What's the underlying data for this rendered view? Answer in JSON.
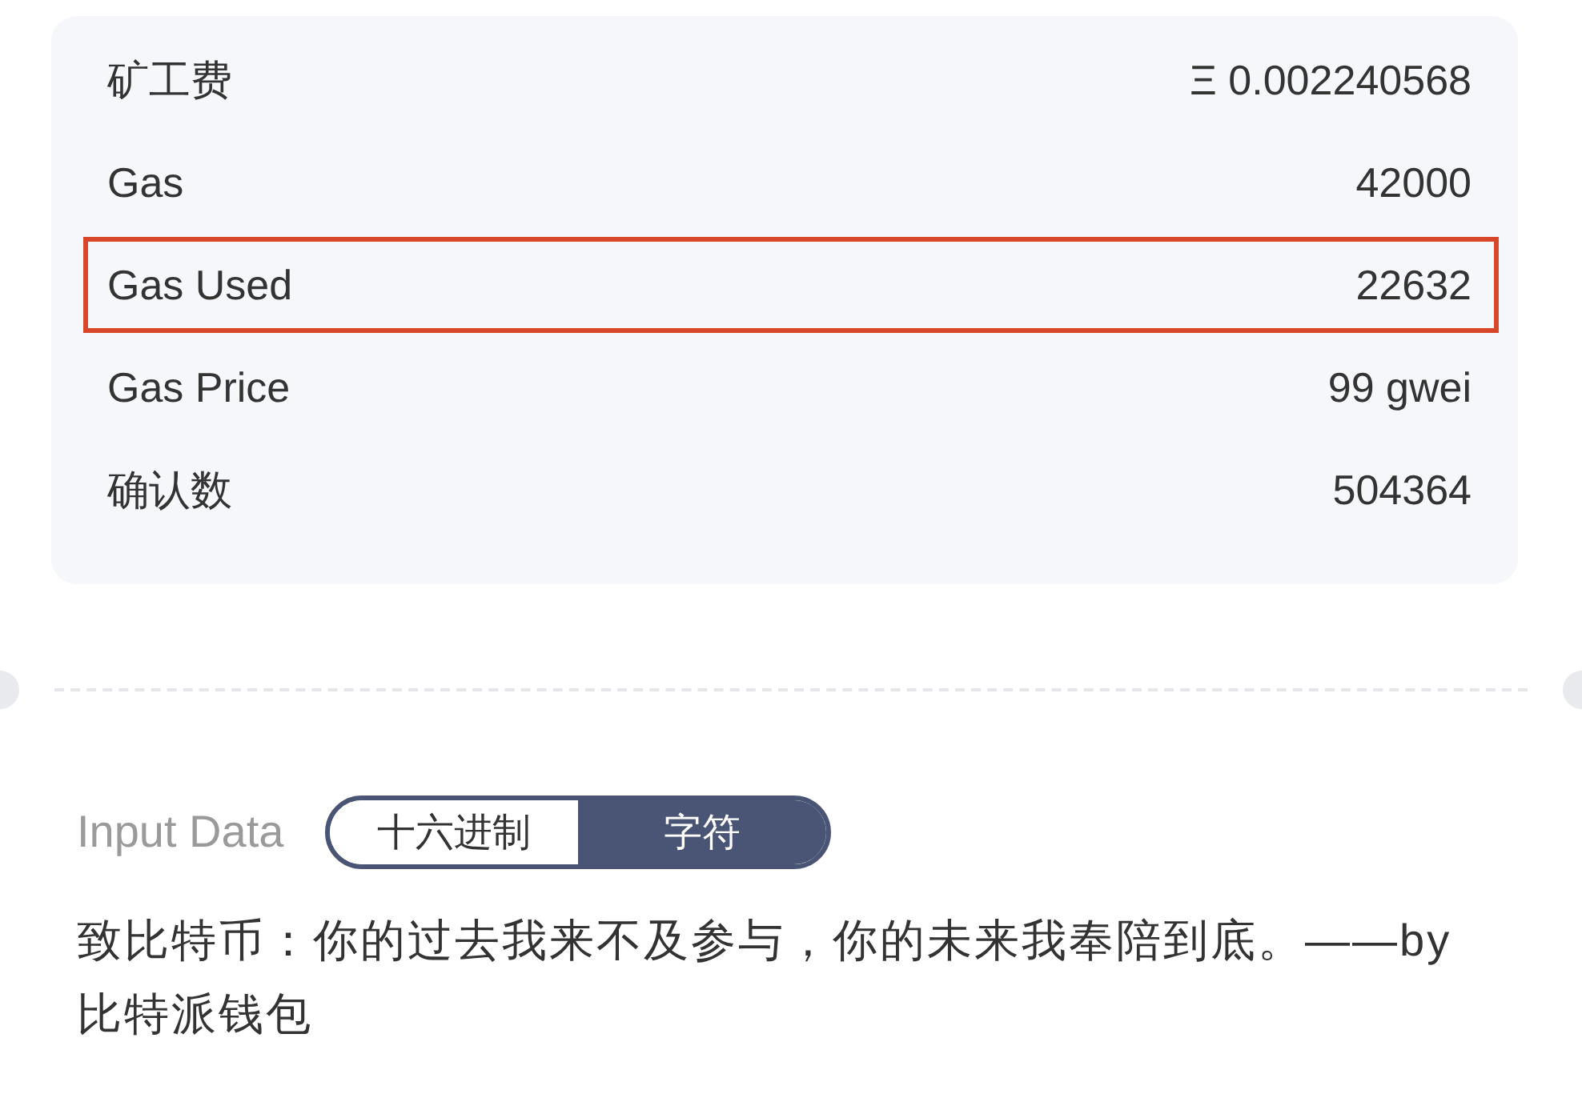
{
  "fee_details": {
    "rows": [
      {
        "label": "矿工费",
        "value": "Ξ 0.002240568",
        "highlighted": false
      },
      {
        "label": "Gas",
        "value": "42000",
        "highlighted": false
      },
      {
        "label": "Gas Used",
        "value": "22632",
        "highlighted": true
      },
      {
        "label": "Gas Price",
        "value": "99 gwei",
        "highlighted": false
      },
      {
        "label": "确认数",
        "value": "504364",
        "highlighted": false
      }
    ]
  },
  "input_data": {
    "label": "Input Data",
    "options": [
      {
        "label": "十六进制",
        "selected": false
      },
      {
        "label": "字符",
        "selected": true
      }
    ],
    "text": "致比特币：你的过去我来不及参与，你的未来我奉陪到底。——by 比特派钱包"
  }
}
